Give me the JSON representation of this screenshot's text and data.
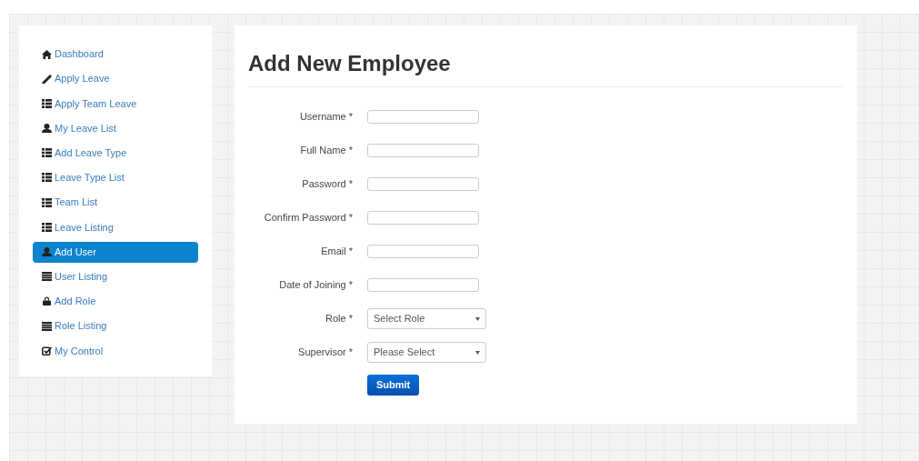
{
  "sidebar": {
    "items": [
      {
        "label": "Dashboard",
        "selected": false
      },
      {
        "label": "Apply Leave",
        "selected": false
      },
      {
        "label": "Apply Team Leave",
        "selected": false
      },
      {
        "label": "My Leave List",
        "selected": false
      },
      {
        "label": "Add Leave Type",
        "selected": false
      },
      {
        "label": "Leave Type List",
        "selected": false
      },
      {
        "label": "Team List",
        "selected": false
      },
      {
        "label": "Leave Listing",
        "selected": false
      },
      {
        "label": "Add User",
        "selected": true
      },
      {
        "label": "User Listing",
        "selected": false
      },
      {
        "label": "Add Role",
        "selected": false
      },
      {
        "label": "Role Listing",
        "selected": false
      },
      {
        "label": "My Control",
        "selected": false
      }
    ]
  },
  "form": {
    "title": "Add New Employee",
    "fields": [
      {
        "label": "Username *",
        "kind": "text"
      },
      {
        "label": "Full Name *",
        "kind": "text"
      },
      {
        "label": "Password *",
        "kind": "text"
      },
      {
        "label": "Confirm Password *",
        "kind": "text"
      },
      {
        "label": "Email *",
        "kind": "text"
      },
      {
        "label": "Date of Joining *",
        "kind": "text"
      },
      {
        "label": "Role *",
        "kind": "select",
        "value": "Select Role"
      },
      {
        "label": "Supervisor *",
        "kind": "select",
        "value": "Please Select"
      }
    ],
    "submit": "Submit"
  }
}
